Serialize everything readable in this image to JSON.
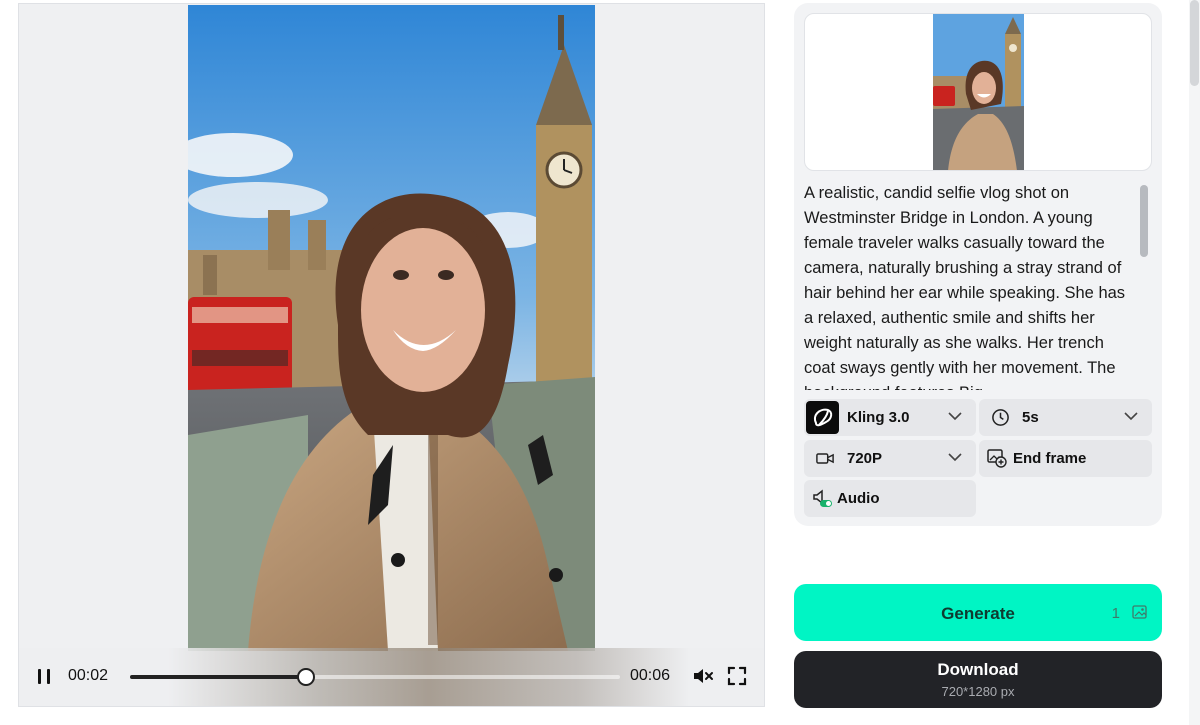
{
  "player": {
    "current_time": "00:02",
    "duration": "00:06",
    "progress": 0.36,
    "muted": true
  },
  "prompt": {
    "text": "A realistic, candid selfie vlog shot on Westminster Bridge in London. A young female traveler walks casually toward the camera, naturally brushing a stray strand of hair behind her ear while speaking. She has a relaxed, authentic smile and shifts her weight naturally as she walks. Her trench coat sways gently with her movement. The background features Big"
  },
  "settings": {
    "model": {
      "label": "Kling 3.0",
      "icon": "kling-logo-icon"
    },
    "duration": {
      "label": "5s",
      "icon": "clock-icon"
    },
    "resolution": {
      "label": "720P",
      "icon": "video-camera-icon"
    },
    "end_frame": {
      "label": "End frame",
      "icon": "image-add-icon"
    },
    "audio": {
      "label": "Audio",
      "icon": "audio-toggle-icon"
    }
  },
  "actions": {
    "generate_label": "Generate",
    "generate_credits": "1",
    "download_label": "Download",
    "download_size": "720*1280 px"
  },
  "colors": {
    "generate_bg": "#00f5c4",
    "download_bg": "#222327",
    "panel_bg": "#f2f3f5",
    "chip_bg": "#e6e7ea"
  }
}
